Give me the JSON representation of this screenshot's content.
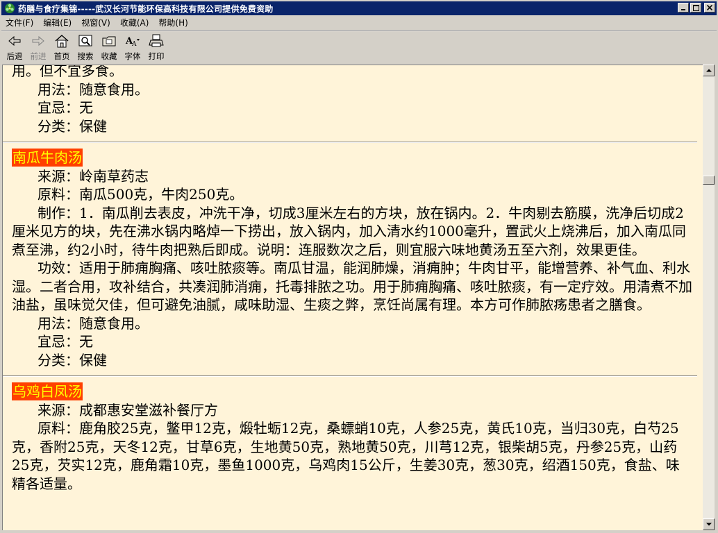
{
  "window": {
    "title": "药膳与食疗集锦-----武汉长河节能环保高科技有限公司提供免费资助"
  },
  "menu": {
    "items": [
      {
        "label": "文件(F)"
      },
      {
        "label": "编辑(E)"
      },
      {
        "label": "视窗(V)"
      },
      {
        "label": "收藏(A)"
      },
      {
        "label": "帮助(H)"
      }
    ]
  },
  "toolbar": {
    "back": "后退",
    "forward": "前进",
    "home": "首页",
    "search": "搜索",
    "favorites": "收藏",
    "font": "字体",
    "print": "打印"
  },
  "content": {
    "top": {
      "line1": "用。但不宜多食。",
      "usage": "用法：随意食用。",
      "taboo": "宜忌：无",
      "category": "分类：保健"
    },
    "recipe1": {
      "title": "南瓜牛肉汤",
      "source": "来源：岭南草药志",
      "ingredients": "原料：南瓜500克，牛肉250克。",
      "method": "制作：1．南瓜削去表皮，冲洗干净，切成3厘米左右的方块，放在锅内。2．牛肉剔去筋膜，洗净后切成2厘米见方的块，先在沸水锅内略焯一下捞出，放入锅内，加入清水约1000毫升，置武火上烧沸后，加入南瓜同煮至沸，约2小时，待牛肉把熟后即成。说明：连服数次之后，则宜服六味地黄汤五至六剂，效果更佳。",
      "effect": "功效：适用于肺痈胸痛、咳吐脓痰等。南瓜甘温，能润肺燥，消痈肿；牛肉甘平，能增营养、补气血、利水湿。二者合用，攻补结合，共凑润肺消痈，托毒排脓之功。用于肺痈胸痛、咳吐脓痰，有一定疗效。用清煮不加油盐，虽味觉欠佳，但可避免油腻，咸味助湿、生痰之弊，烹饪尚属有理。本方可作肺脓疡患者之膳食。",
      "usage": "用法：随意食用。",
      "taboo": "宜忌：无",
      "category": "分类：保健"
    },
    "recipe2": {
      "title": "乌鸡白凤汤",
      "source": "来源：成都惠安堂滋补餐厅方",
      "ingredients": "原料：鹿角胶25克，鳖甲12克，煅牡蛎12克，桑螵蛸10克，人参25克，黄氏10克，当归30克，白芍25克，香附25克，天冬12克，甘草6克，生地黄50克，熟地黄50克，川芎12克，银柴胡5克，丹参25克，山药25克，芡实12克，鹿角霜10克，墨鱼1000克，乌鸡肉15公斤，生姜30克，葱30克，绍酒150克，食盐、味精各适量。"
    }
  },
  "colors": {
    "title_bar": "#0a246a",
    "content_bg": "#fff4d9",
    "recipe_title_bg": "#ff4000",
    "recipe_title_fg": "#ffff00"
  }
}
